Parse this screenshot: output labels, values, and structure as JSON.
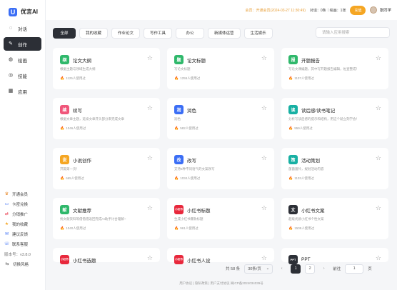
{
  "app": {
    "logo_letter": "U",
    "name": "优言AI"
  },
  "sidebar": {
    "items": [
      {
        "label": "对话",
        "icon": "chat-icon"
      },
      {
        "label": "创作",
        "icon": "pen-icon",
        "active": true
      },
      {
        "label": "绘画",
        "icon": "palette-icon"
      },
      {
        "label": "技能",
        "icon": "skill-icon"
      },
      {
        "label": "应用",
        "icon": "apps-icon"
      }
    ],
    "bottom": [
      {
        "label": "开通会员",
        "icon": "crown-icon"
      },
      {
        "label": "卡密兑换",
        "icon": "card-icon"
      },
      {
        "label": "分销推广",
        "icon": "share-icon"
      },
      {
        "label": "我的收藏",
        "icon": "favorite-icon"
      },
      {
        "label": "建议反馈",
        "icon": "feedback-icon"
      },
      {
        "label": "联系客服",
        "icon": "service-icon"
      }
    ],
    "version": "版本号：v3.8.0",
    "logout": "切换风格"
  },
  "topbar": {
    "vip_text": "会员：开通会员(2024-03-27 11:30:49)",
    "stats": "对话：0条｜绘画：1张",
    "upgrade_label": "充值",
    "user_name": "张同学"
  },
  "categories": [
    "全部",
    "我的收藏",
    "作业论文",
    "写作工具",
    "办公",
    "新媒体运营",
    "生活娱乐"
  ],
  "search": {
    "placeholder": "请输入应用搜索"
  },
  "cards": [
    {
      "title": "论文大纲",
      "desc": "根据主题与领域生成大纲",
      "uses": "1125人使用过",
      "icon_color": "#2fb86b",
      "icon_text": "纲"
    },
    {
      "title": "论文标题",
      "desc": "写论文标题",
      "uses": "1255人使用过",
      "icon_color": "#2fb86b",
      "icon_text": "题"
    },
    {
      "title": "开题报告",
      "desc": "写论文课编题，其中写开题报告编辑，佐查整成！",
      "uses": "1107人使用过",
      "icon_color": "#2fb86b",
      "icon_text": "报"
    },
    {
      "title": "续写",
      "desc": "根据文章主题，延续文章开头部分来完成文章",
      "uses": "1046人使用过",
      "icon_color": "#f0567a",
      "icon_text": "续"
    },
    {
      "title": "润色",
      "desc": "润色",
      "uses": "582人使用过",
      "icon_color": "#3b6ef5",
      "icon_text": "润"
    },
    {
      "title": "读后感/读书笔记",
      "desc": "分析写读后感的提示和结构，用这个就立刻学会！",
      "uses": "959人使用过",
      "icon_color": "#18b0a3",
      "icon_text": "读"
    },
    {
      "title": "小说创作",
      "desc": "开篇第一页！",
      "uses": "665人使用过",
      "icon_color": "#f5a623",
      "icon_text": "说"
    },
    {
      "title": "改写",
      "desc": "支持5种不同语气的文案改写",
      "uses": "1034人使用过",
      "icon_color": "#3b6ef5",
      "icon_text": "改"
    },
    {
      "title": "活动策划",
      "desc": "菌菌菌怜，规划活动内容",
      "uses": "1103人使用过",
      "icon_color": "#18b0a3",
      "icon_text": "策"
    },
    {
      "title": "文献推荐",
      "desc": "找文献资料等借借借返回完成AI助手讨合理解~",
      "uses": "1040人使用过",
      "icon_color": "#2fb86b",
      "icon_text": "献"
    },
    {
      "title": "小红书标题",
      "desc": "生成小红书爆款标题",
      "uses": "961人使用过",
      "icon_color": "#e8283c",
      "icon_text": "小红书"
    },
    {
      "title": "小红书文案",
      "desc": "超级优质小红书个性文案",
      "uses": "1509人使用过",
      "icon_color": "#2c2f36",
      "icon_text": "文"
    },
    {
      "title": "小红书选题",
      "desc": "",
      "uses": "",
      "icon_color": "#e8283c",
      "icon_text": "小红书"
    },
    {
      "title": "小红书人设",
      "desc": "",
      "uses": "",
      "icon_color": "#e8283c",
      "icon_text": "小红书"
    },
    {
      "title": "PPT",
      "desc": "",
      "uses": "",
      "icon_color": "#2c2f36",
      "icon_text": "PPT"
    }
  ],
  "pagination": {
    "total": "共 58 条",
    "page_size": "30条/页",
    "pages": [
      "1",
      "2"
    ],
    "current": "1",
    "jump_label": "前往",
    "jump_value": "1",
    "page_unit": "页"
  },
  "footer": "用户协议 | 隐私政策 | 用户支付协议  闽ICP备2024034039号"
}
